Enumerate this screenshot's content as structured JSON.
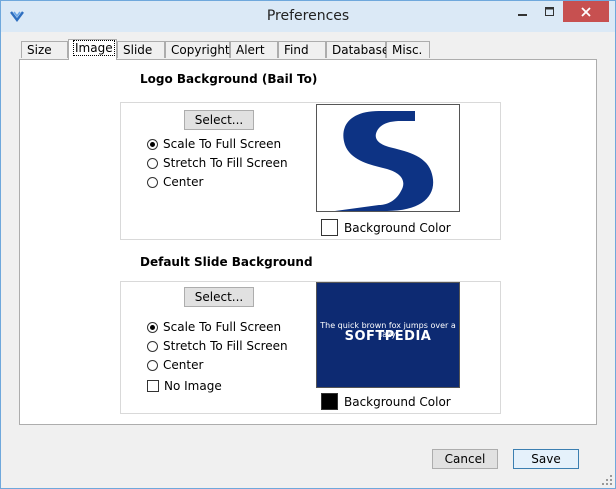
{
  "window": {
    "title": "Preferences",
    "accent": "#6fa8dc",
    "close_color": "#c75050"
  },
  "window_controls": {
    "minimize_icon": "minimize-icon",
    "maximize_icon": "maximize-icon",
    "close_icon": "close-icon"
  },
  "tabs": [
    {
      "label": "Size"
    },
    {
      "label": "Image"
    },
    {
      "label": "Slide"
    },
    {
      "label": "Copyright"
    },
    {
      "label": "Alert"
    },
    {
      "label": "Find"
    },
    {
      "label": "Database"
    },
    {
      "label": "Misc."
    }
  ],
  "active_tab": "Image",
  "logo_section": {
    "title": "Logo Background (Bail To)",
    "select_label": "Select...",
    "options": [
      "Scale To Full Screen",
      "Stretch To Fill Screen",
      "Center"
    ],
    "selected": "Scale To Full Screen",
    "background_color_label": "Background Color",
    "background_color": "#ffffff",
    "preview_color": "#0d3384"
  },
  "slide_section": {
    "title": "Default Slide Background",
    "select_label": "Select...",
    "options": [
      "Scale To Full Screen",
      "Stretch To Fill Screen",
      "Center"
    ],
    "selected": "Scale To Full Screen",
    "no_image_label": "No Image",
    "no_image_checked": false,
    "background_color_label": "Background Color",
    "background_color": "#000000",
    "preview_bg": "#0d2a72",
    "preview_text": "The quick brown fox jumps over a lazy",
    "preview_logo": "SOFTPEDIA"
  },
  "buttons": {
    "cancel": "Cancel",
    "save": "Save"
  }
}
